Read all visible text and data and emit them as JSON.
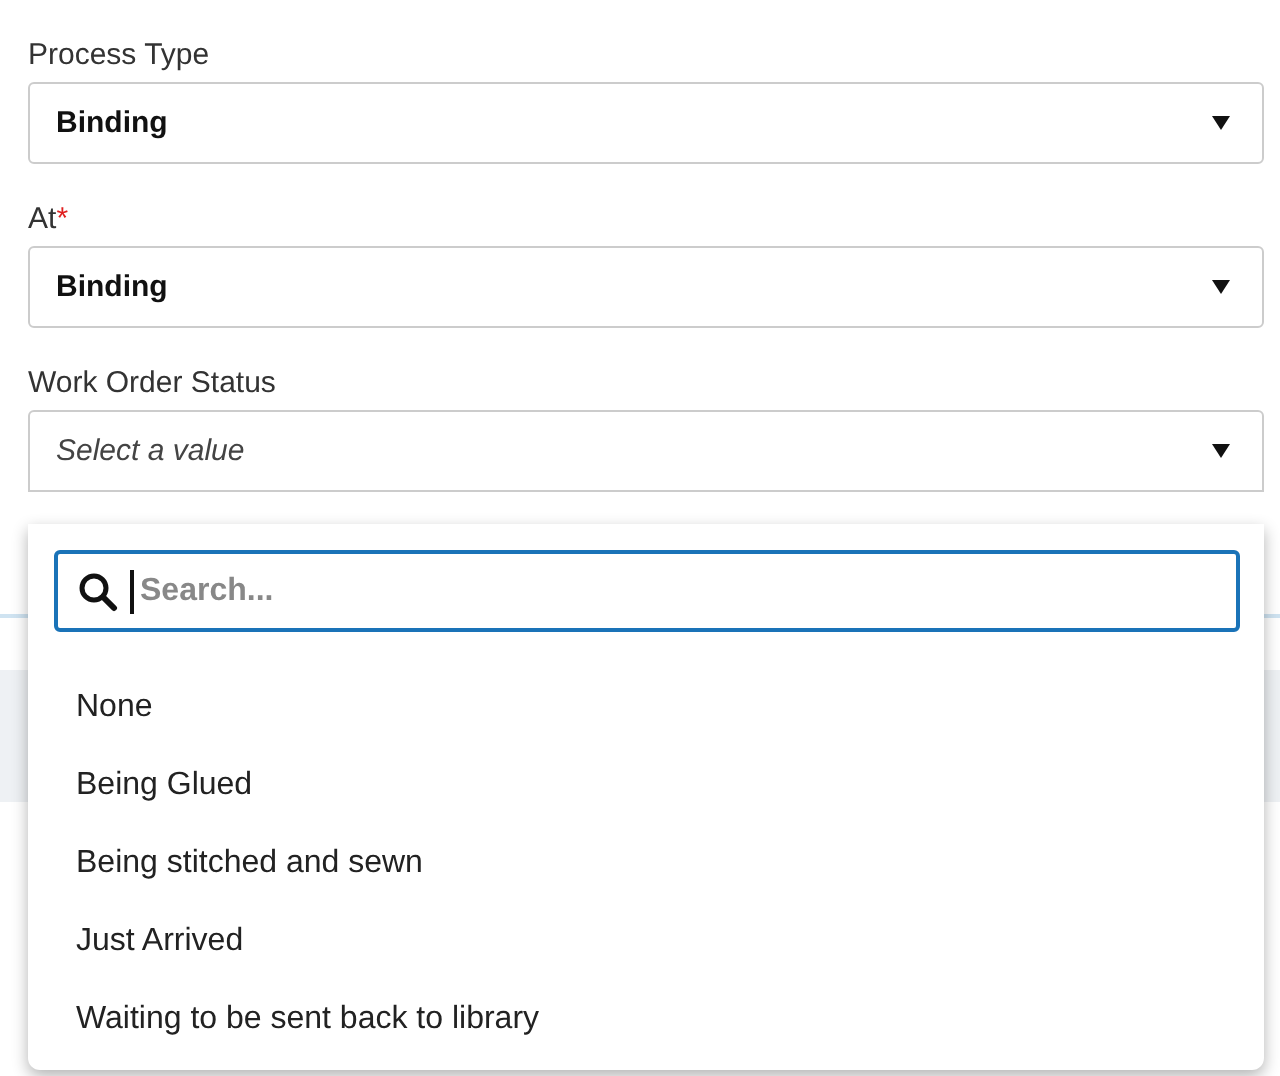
{
  "fields": [
    {
      "label": "Process Type",
      "value": "Binding"
    },
    {
      "label": "At",
      "required_mark": "*",
      "value": "Binding"
    },
    {
      "label": "Work Order Status",
      "placeholder": "Select a value",
      "open": true
    }
  ],
  "dropdown": {
    "search": {
      "placeholder": "Search..."
    },
    "options": [
      {
        "label": "None"
      },
      {
        "label": "Being Glued"
      },
      {
        "label": "Being stitched and sewn"
      },
      {
        "label": "Just Arrived"
      },
      {
        "label": "Waiting to be sent back to library"
      }
    ]
  }
}
